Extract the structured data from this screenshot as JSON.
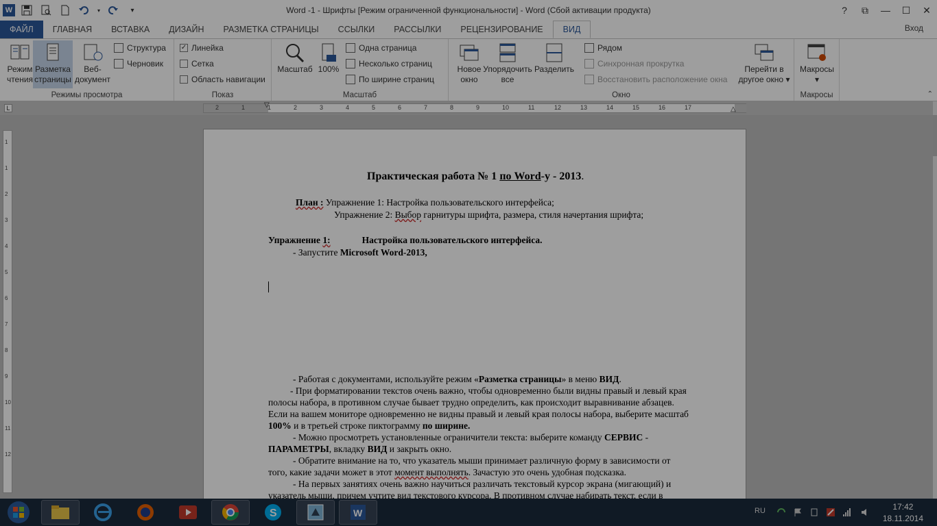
{
  "window": {
    "title": "Word -1 - Шрифты [Режим ограниченной функциональности] - Word (Сбой активации продукта)",
    "controls": {
      "help": "?",
      "restore_ribbon": "⧉",
      "minimize": "—",
      "maximize": "☐",
      "close": "✕"
    }
  },
  "tabs": [
    {
      "label": "ФАЙЛ"
    },
    {
      "label": "ГЛАВНАЯ"
    },
    {
      "label": "ВСТАВКА"
    },
    {
      "label": "ДИЗАЙН"
    },
    {
      "label": "РАЗМЕТКА СТРАНИЦЫ"
    },
    {
      "label": "ССЫЛКИ"
    },
    {
      "label": "РАССЫЛКИ"
    },
    {
      "label": "РЕЦЕНЗИРОВАНИЕ"
    },
    {
      "label": "ВИД"
    }
  ],
  "signin": "Вход",
  "ribbon": {
    "views": {
      "label": "Режимы просмотра",
      "read_mode_1": "Режим",
      "read_mode_2": "чтения",
      "print_layout_1": "Разметка",
      "print_layout_2": "страницы",
      "web_layout_1": "Веб-",
      "web_layout_2": "документ",
      "outline": "Структура",
      "draft": "Черновик"
    },
    "show": {
      "label": "Показ",
      "ruler": "Линейка",
      "gridlines": "Сетка",
      "nav_pane": "Область навигации"
    },
    "zoom": {
      "label": "Масштаб",
      "zoom": "Масштаб",
      "hundred": "100%",
      "one_page": "Одна страница",
      "multiple": "Несколько страниц",
      "page_width": "По ширине страниц"
    },
    "window": {
      "label": "Окно",
      "new_window_1": "Новое",
      "new_window_2": "окно",
      "arrange_1": "Упорядочить",
      "arrange_2": "все",
      "split": "Разделить",
      "side_by_side": "Рядом",
      "sync_scroll": "Синхронная прокрутка",
      "reset_pos": "Восстановить расположение окна",
      "switch_1": "Перейти в",
      "switch_2": "другое окно"
    },
    "macros": {
      "label": "Макросы",
      "macros": "Макросы"
    }
  },
  "ruler": {
    "corner": "L",
    "ticks": [
      "2",
      "1",
      "1",
      "2",
      "3",
      "4",
      "5",
      "6",
      "7",
      "8",
      "9",
      "10",
      "11",
      "12",
      "13",
      "14",
      "15",
      "16",
      "17"
    ],
    "vticks": [
      "1",
      "1",
      "2",
      "3",
      "4",
      "5",
      "6",
      "7",
      "8",
      "9",
      "10",
      "11",
      "12"
    ]
  },
  "document": {
    "title_a": "Практическая   работа № 1   ",
    "title_b": "по  Word",
    "title_c": "-у - 2013",
    "title_d": ".",
    "plan_label": "План :",
    "plan_1": "  Упражнение 1:  Настройка пользовательского интерфейса;",
    "plan_2a": "Упражнение 2",
    "plan_2b": ":  ",
    "plan_2c": "Выбор",
    "plan_2d": " гарнитуры шрифта, размера, стиля начертания шрифта;",
    "ex1_a": "Упражнение ",
    "ex1_b": "1:",
    "ex1_c": "Настройка пользовательского интерфейса.",
    "launch_a": "-  Запустите ",
    "launch_b": "Microsoft Word-2013,",
    "work_a": "-  Работая с документами, используйте режим «",
    "work_b": "Разметка страницы",
    "work_c": "» в меню ",
    "work_d": "ВИД",
    "work_e": ".",
    "l1": "-  При форматировании текстов очень важно, чтобы одновременно были видны правый и левый края",
    "l2": "полосы набора, в противном случае бывает трудно определить, как происходит выравнивание абзацев.",
    "l3": "Если на вашем мониторе одновременно не видны правый и левый края полосы набора, выберите масштаб",
    "l4a": "100%",
    "l4b": " и в третьей строке пиктограмму ",
    "l4c": "по ширине.",
    "l5a": "-    Можно просмотреть установленные ограничители текста: выберите команду ",
    "l5b": "СЕРВИС",
    "l5c": " -",
    "l6a": "ПАРАМЕТРЫ",
    "l6b": ", вкладку ",
    "l6c": "ВИД",
    "l6d": " и закрыть окно.",
    "l7": "-    Обратите внимание на то, что указатель мыши принимает различную форму в зависимости от",
    "l8a": "того, какие задачи может в этот ",
    "l8b": "момент  выполнять",
    "l8c": ". Зачастую это очень удобная подсказка.",
    "l9": "-    На первых занятиях очень важно научиться различать текстовый курсор экрана (мигающий) и",
    "l10": "указатель мыши, причем учтите вид текстового курсора. В противном случае набирать текст, если в"
  },
  "taskbar": {
    "lang": "RU",
    "time": "17:42",
    "date": "18.11.2014"
  },
  "colors": {
    "word_blue": "#2b579a",
    "taskbar": "#1b2a3d"
  }
}
